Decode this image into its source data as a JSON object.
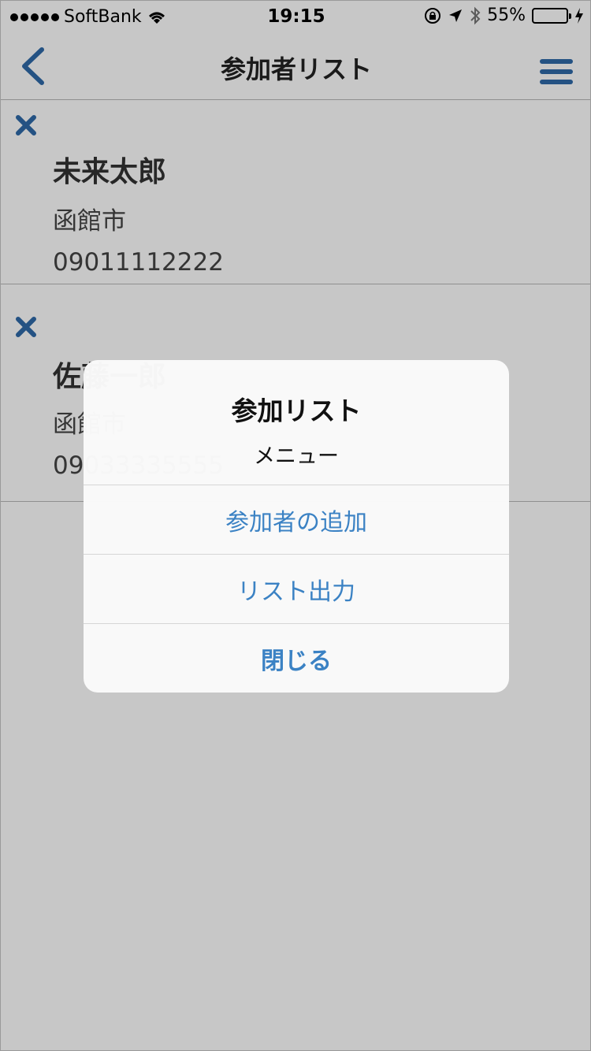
{
  "status_bar": {
    "carrier": "SoftBank",
    "time": "19:15",
    "battery_percent": "55%",
    "battery_level": 0.55
  },
  "nav": {
    "title": "参加者リスト",
    "back_icon": "chevron-left-icon",
    "menu_icon": "hamburger-menu-icon"
  },
  "participants": [
    {
      "name": "未来太郎",
      "city": "函館市",
      "phone": "09011112222"
    },
    {
      "name": "佐藤一郎",
      "city": "函館市",
      "phone": "09033335555"
    }
  ],
  "alert": {
    "title": "参加リスト",
    "message": "メニュー",
    "actions": [
      "参加者の追加",
      "リスト出力",
      "閉じる"
    ]
  },
  "colors": {
    "accent": "#2f6aa8",
    "action_text": "#3b82c4",
    "battery": "#4cd964"
  }
}
